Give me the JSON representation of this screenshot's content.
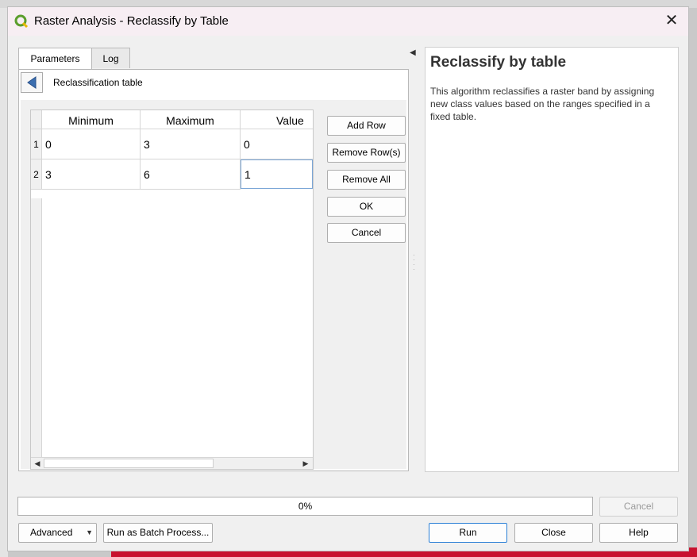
{
  "window": {
    "title": "Raster Analysis - Reclassify by Table",
    "close_label": "✕"
  },
  "tabs": [
    {
      "label": "Parameters"
    },
    {
      "label": "Log"
    }
  ],
  "panel": {
    "breadcrumb": "Reclassification table"
  },
  "table": {
    "columns": [
      "Minimum",
      "Maximum",
      "Value"
    ],
    "rows": [
      {
        "index": "1",
        "cells": [
          "0",
          "3",
          "0"
        ]
      },
      {
        "index": "2",
        "cells": [
          "3",
          "6",
          "1"
        ]
      }
    ]
  },
  "table_buttons": {
    "add_row": "Add Row",
    "remove_rows": "Remove Row(s)",
    "remove_all": "Remove All",
    "ok": "OK",
    "cancel": "Cancel"
  },
  "help": {
    "title": "Reclassify by table",
    "text": "This algorithm reclassifies a raster band by assigning new class values based on the ranges specified in a fixed table."
  },
  "progress": {
    "value": 0,
    "label": "0%"
  },
  "footer": {
    "cancel": "Cancel",
    "advanced": "Advanced",
    "batch": "Run as Batch Process...",
    "run": "Run",
    "close": "Close",
    "help": "Help"
  },
  "colors": {
    "accent": "#2b80d6",
    "qgis_green": "#5b9e2d",
    "back_arrow": "#3c6fb0"
  }
}
